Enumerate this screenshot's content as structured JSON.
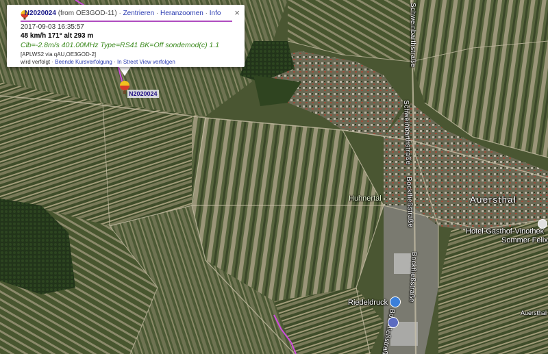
{
  "popup": {
    "callsign": "N2020024",
    "from_text": "(from OE3GOD-11)",
    "sep": "·",
    "links": [
      "Zentrieren",
      "Heranzoomen",
      "Info"
    ],
    "timestamp": "2017-09-03 16:35:57",
    "speed_line": "48 km/h 171° alt 293 m",
    "comment": "Clb=-2.8m/s 401.00MHz Type=RS41 BK=Off sondemod(c) 1.1",
    "path": "[APLWS2 via qAU,OE3GOD-2]",
    "follow_prefix": "wird verfolgt ·",
    "follow_links": [
      "Beende Kursverfolgung",
      "In Street View verfolgen"
    ],
    "follow_sep": "·",
    "close": "×"
  },
  "marker": {
    "label": "N2020024",
    "icon": "balloon-icon"
  },
  "places": {
    "huhnertal": "Huhnertal",
    "auersthal": "Auersthal",
    "hotel_line1": "Hotel-Gasthof-Vinothek",
    "hotel_line2": "Sommer Felix",
    "riedeldruck": "Riedeldruck",
    "auersthal_small": "Auersthal Bah"
  },
  "streets": {
    "schweinbarth": "Schweinbarthstraße",
    "bockfliess1": "Bockfließstraße",
    "bockfliess2": "Bockfließstraße",
    "bockfliess3": "Bockfließstraße"
  },
  "colors": {
    "track": "#d24be0",
    "popup_rule": "#b04cc0",
    "field_dark": "#3e4b2a",
    "field_light": "#9a9a7a"
  }
}
